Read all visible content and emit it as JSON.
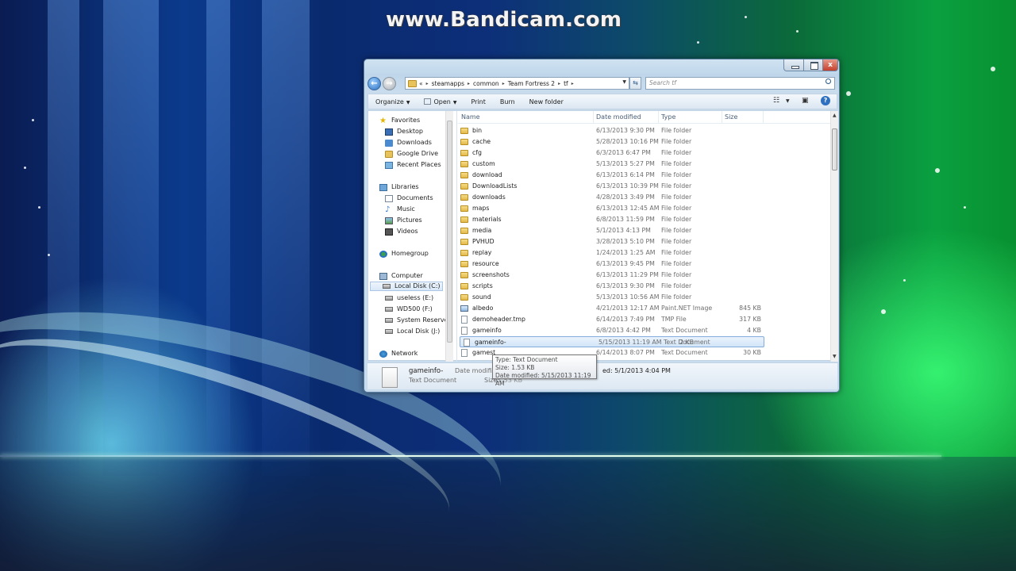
{
  "watermark": "www.Bandicam.com",
  "window": {
    "close_glyph": "x"
  },
  "nav": {
    "breadcrumb": [
      "«",
      "steamapps",
      "common",
      "Team Fortress 2",
      "tf"
    ],
    "search_placeholder": "Search tf"
  },
  "toolbar": {
    "organize": "Organize",
    "open": "Open",
    "print": "Print",
    "burn": "Burn",
    "new_folder": "New folder"
  },
  "sidebar": {
    "favorites": "Favorites",
    "desktop": "Desktop",
    "downloads": "Downloads",
    "google_drive": "Google Drive",
    "recent_places": "Recent Places",
    "libraries": "Libraries",
    "documents": "Documents",
    "music": "Music",
    "pictures": "Pictures",
    "videos": "Videos",
    "homegroup": "Homegroup",
    "computer": "Computer",
    "local_disk_c": "Local Disk (C:)",
    "useless_e": "useless (E:)",
    "wd500_f": "WD500 (F:)",
    "system_reserved": "System Reserved",
    "local_disk_j": "Local Disk (J:)",
    "network": "Network"
  },
  "columns": {
    "name": "Name",
    "date": "Date modified",
    "type": "Type",
    "size": "Size"
  },
  "files": [
    {
      "name": "bin",
      "date": "6/13/2013 9:30 PM",
      "type": "File folder",
      "size": ""
    },
    {
      "name": "cache",
      "date": "5/28/2013 10:16 PM",
      "type": "File folder",
      "size": ""
    },
    {
      "name": "cfg",
      "date": "6/3/2013 6:47 PM",
      "type": "File folder",
      "size": ""
    },
    {
      "name": "custom",
      "date": "5/13/2013 5:27 PM",
      "type": "File folder",
      "size": ""
    },
    {
      "name": "download",
      "date": "6/13/2013 6:14 PM",
      "type": "File folder",
      "size": ""
    },
    {
      "name": "DownloadLists",
      "date": "6/13/2013 10:39 PM",
      "type": "File folder",
      "size": ""
    },
    {
      "name": "downloads",
      "date": "4/28/2013 3:49 PM",
      "type": "File folder",
      "size": ""
    },
    {
      "name": "maps",
      "date": "6/13/2013 12:45 AM",
      "type": "File folder",
      "size": ""
    },
    {
      "name": "materials",
      "date": "6/8/2013 11:59 PM",
      "type": "File folder",
      "size": ""
    },
    {
      "name": "media",
      "date": "5/1/2013 4:13 PM",
      "type": "File folder",
      "size": ""
    },
    {
      "name": "PVHUD",
      "date": "3/28/2013 5:10 PM",
      "type": "File folder",
      "size": ""
    },
    {
      "name": "replay",
      "date": "1/24/2013 1:25 AM",
      "type": "File folder",
      "size": ""
    },
    {
      "name": "resource",
      "date": "6/13/2013 9:45 PM",
      "type": "File folder",
      "size": ""
    },
    {
      "name": "screenshots",
      "date": "6/13/2013 11:29 PM",
      "type": "File folder",
      "size": ""
    },
    {
      "name": "scripts",
      "date": "6/13/2013 9:30 PM",
      "type": "File folder",
      "size": ""
    },
    {
      "name": "sound",
      "date": "5/13/2013 10:56 AM",
      "type": "File folder",
      "size": ""
    },
    {
      "name": "albedo",
      "date": "4/21/2013 12:17 AM",
      "type": "Paint.NET Image",
      "size": "845 KB"
    },
    {
      "name": "demoheader.tmp",
      "date": "6/14/2013 7:49 PM",
      "type": "TMP File",
      "size": "317 KB"
    },
    {
      "name": "gameinfo",
      "date": "6/8/2013 4:42 PM",
      "type": "Text Document",
      "size": "4 KB"
    },
    {
      "name": "gameinfo-",
      "date": "5/15/2013 11:19 AM",
      "type": "Text Document",
      "size": "2 KB"
    },
    {
      "name": "gamest",
      "date": "6/14/2013 8:07 PM",
      "type": "Text Document",
      "size": "30 KB"
    }
  ],
  "details": {
    "name": "gameinfo-",
    "type": "Text Document",
    "date_label": "Date modifi",
    "size_label": "Size:",
    "size_value": "1.53 KB",
    "created": "ed: 5/1/2013 4:04 PM"
  },
  "tooltip": {
    "type": "Type: Text Document",
    "size": "Size: 1.53 KB",
    "date": "Date modified: 5/15/2013 11:19 AM"
  }
}
